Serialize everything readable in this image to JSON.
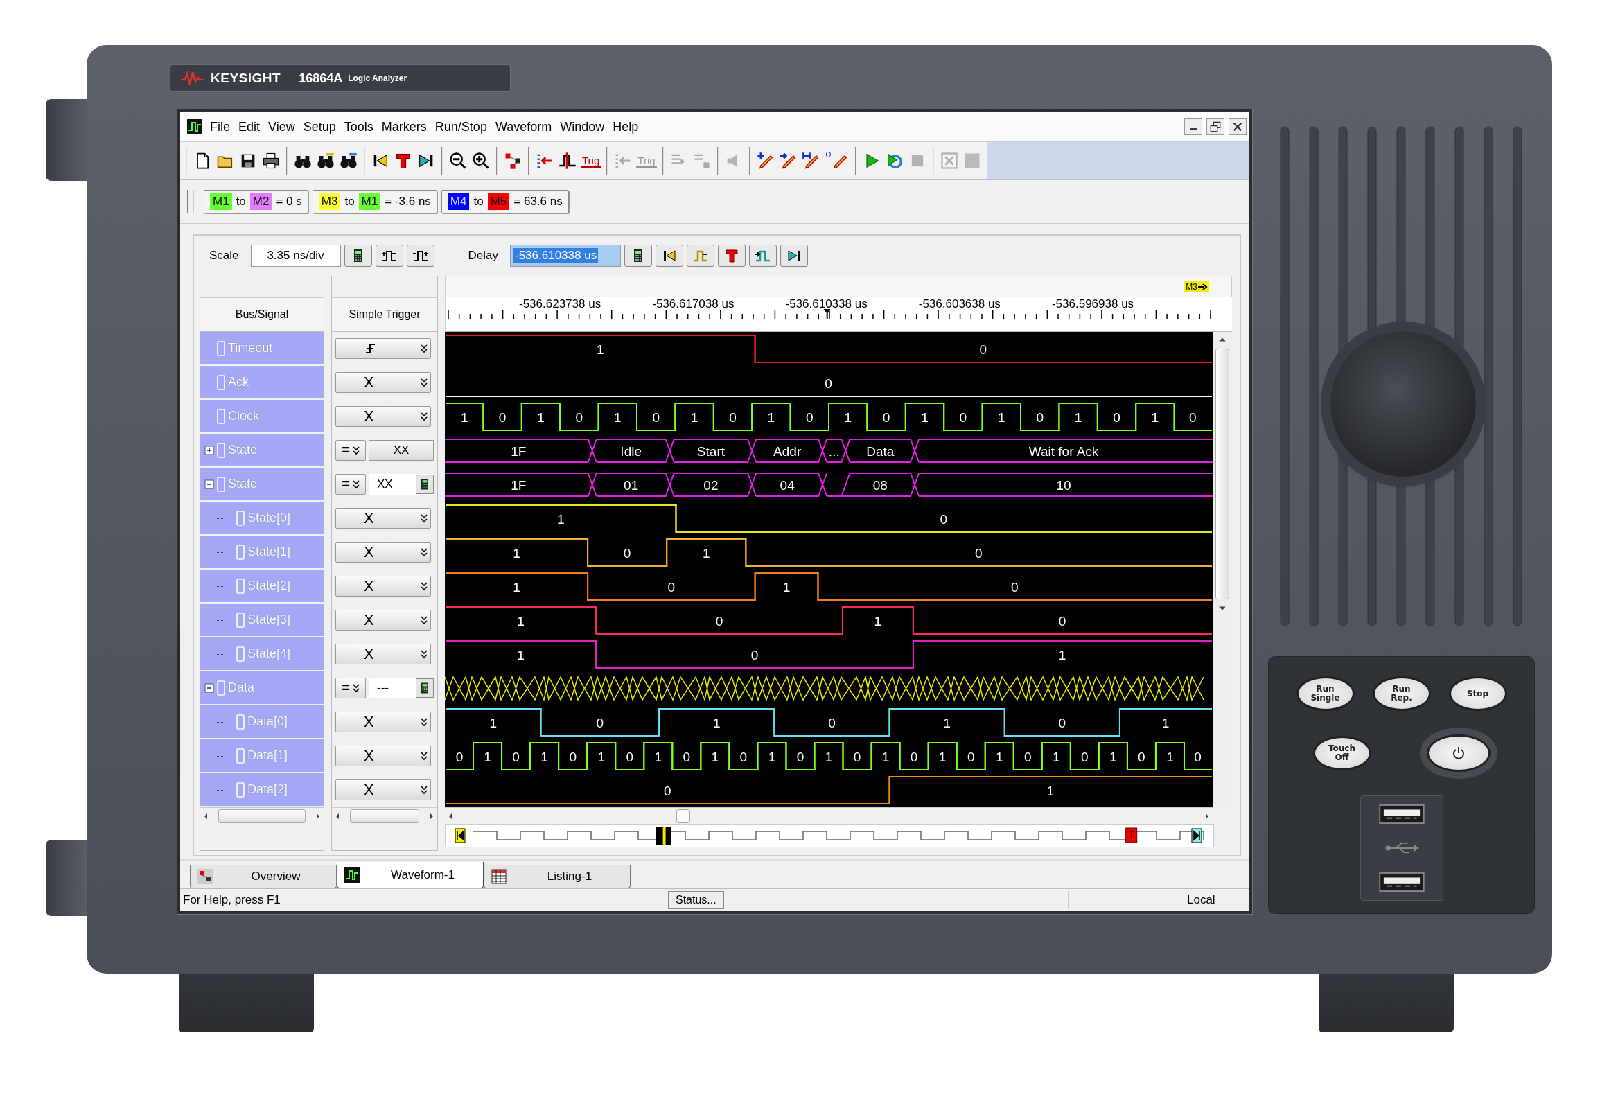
{
  "device": {
    "brand": "KEYSIGHT",
    "model": "16864A",
    "product": "Logic Analyzer"
  },
  "app": {
    "menu": [
      "File",
      "Edit",
      "View",
      "Setup",
      "Tools",
      "Markers",
      "Run/Stop",
      "Waveform",
      "Window",
      "Help"
    ],
    "toolbar": [
      [
        {
          "kind": "new",
          "disabled": false
        },
        {
          "kind": "open",
          "disabled": false
        },
        {
          "kind": "save",
          "disabled": false
        },
        {
          "kind": "print",
          "disabled": false
        }
      ],
      [
        {
          "kind": "find",
          "disabled": false
        },
        {
          "kind": "findPrev",
          "disabled": false
        },
        {
          "kind": "findNext",
          "disabled": false
        }
      ],
      [
        {
          "kind": "goStart",
          "disabled": false
        },
        {
          "kind": "trigger",
          "disabled": false
        },
        {
          "kind": "goEnd",
          "disabled": false
        }
      ],
      [
        {
          "kind": "zoomOut",
          "disabled": false
        },
        {
          "kind": "zoomIn",
          "disabled": false
        }
      ],
      [
        {
          "kind": "overview",
          "disabled": false
        }
      ],
      [
        {
          "kind": "insert",
          "disabled": false
        },
        {
          "kind": "edge",
          "disabled": false
        },
        {
          "kind": "label",
          "label": "Trig",
          "disabled": false
        }
      ],
      [
        {
          "kind": "listGrey",
          "disabled": true
        },
        {
          "kind": "label",
          "label": "Trig",
          "disabled": true
        }
      ],
      [
        {
          "kind": "moveRight",
          "disabled": true
        },
        {
          "kind": "moveSq",
          "disabled": true
        }
      ],
      [
        {
          "kind": "speaker",
          "disabled": true
        }
      ],
      [
        {
          "kind": "markerAdd",
          "disabled": false
        },
        {
          "kind": "markerArrow",
          "disabled": false
        },
        {
          "kind": "markerH",
          "disabled": false
        },
        {
          "kind": "markerOf",
          "label": "OF",
          "disabled": false
        }
      ],
      [
        {
          "kind": "run",
          "disabled": false
        },
        {
          "kind": "runRepeat",
          "disabled": false
        },
        {
          "kind": "stop",
          "disabled": true
        }
      ],
      [
        {
          "kind": "cancel",
          "disabled": true
        },
        {
          "kind": "square",
          "disabled": true
        }
      ]
    ],
    "marker_measurements": [
      {
        "from": {
          "label": "M1",
          "color": "#66ff33"
        },
        "joiner": "to",
        "to": {
          "label": "M2",
          "color": "#e07cff"
        },
        "result": "= 0 s"
      },
      {
        "from": {
          "label": "M3",
          "color": "#ffff33"
        },
        "joiner": "to",
        "to": {
          "label": "M1",
          "color": "#66ff33"
        },
        "result": "= -3.6 ns"
      },
      {
        "from": {
          "label": "M4",
          "color": "#0000ff"
        },
        "joiner": "to",
        "to": {
          "label": "M5",
          "color": "#ff0000"
        },
        "result": "= 63.6 ns"
      }
    ],
    "scale": {
      "label": "Scale",
      "value": "3.35 ns/div"
    },
    "delay": {
      "label": "Delay",
      "value": "-536.610338 us"
    },
    "columns": [
      "Bus/Signal",
      "Simple Trigger"
    ],
    "marker_flag": "M3",
    "ruler": [
      "-536.623738 us",
      "-536.617038 us",
      "-536.610338 us",
      "-536.603638 us",
      "-536.596938 us"
    ],
    "signals": [
      {
        "name": "Timeout",
        "color": "#ff1a1a",
        "trigger": {
          "kind": "edge"
        },
        "waveform": {
          "kind": "bit",
          "segments": [
            {
              "value": "1",
              "high": true
            },
            {
              "value": "0",
              "high": false
            }
          ]
        }
      },
      {
        "name": "Ack",
        "color": "#ffffff",
        "trigger": {
          "kind": "select",
          "value": "X"
        },
        "waveform": {
          "kind": "bit",
          "segments": [
            {
              "value": "0",
              "high": false
            }
          ]
        }
      },
      {
        "name": "Clock",
        "color": "#7fff1f",
        "trigger": {
          "kind": "select",
          "value": "X"
        },
        "waveform": {
          "kind": "clock",
          "segments": [
            {
              "value": "1",
              "high": true
            },
            {
              "value": "0",
              "high": false
            },
            {
              "value": "1",
              "high": true
            },
            {
              "value": "0",
              "high": false
            },
            {
              "value": "1",
              "high": true
            },
            {
              "value": "0",
              "high": false
            },
            {
              "value": "1",
              "high": true
            },
            {
              "value": "0",
              "high": false
            },
            {
              "value": "1",
              "high": true
            },
            {
              "value": "0",
              "high": false
            },
            {
              "value": "1",
              "high": true
            },
            {
              "value": "0",
              "high": false
            },
            {
              "value": "1",
              "high": true
            },
            {
              "value": "0",
              "high": false
            },
            {
              "value": "1",
              "high": true
            },
            {
              "value": "0",
              "high": false
            },
            {
              "value": "1",
              "high": true
            },
            {
              "value": "0",
              "high": false
            },
            {
              "value": "1",
              "high": true
            },
            {
              "value": "0",
              "high": false
            }
          ]
        }
      },
      {
        "name": "State",
        "expanded": false,
        "color": "#e81ee8",
        "trigger": {
          "kind": "bus",
          "operator": "=",
          "value": "XX",
          "calculator": false
        },
        "waveform": {
          "kind": "bus",
          "segments": [
            {
              "value": "1F"
            },
            {
              "value": "Idle"
            },
            {
              "value": "Start"
            },
            {
              "value": "Addr"
            },
            {
              "value": "..."
            },
            {
              "value": "Data"
            },
            {
              "value": "Wait for Ack"
            }
          ]
        }
      },
      {
        "name": "State",
        "expanded": true,
        "color": "#e81ee8",
        "trigger": {
          "kind": "bus",
          "operator": "=",
          "value": "XX",
          "calculator": true
        },
        "waveform": {
          "kind": "bus",
          "segments": [
            {
              "value": "1F"
            },
            {
              "value": "01"
            },
            {
              "value": "02"
            },
            {
              "value": "04"
            },
            {
              "value": "08"
            },
            {
              "value": "10"
            }
          ]
        },
        "children": [
          {
            "name": "State[0]",
            "color": "#e8e820",
            "trigger": {
              "kind": "select",
              "value": "X"
            },
            "waveform": {
              "kind": "bit",
              "segments": [
                {
                  "value": "1",
                  "high": true
                },
                {
                  "value": "0",
                  "high": false
                }
              ]
            }
          },
          {
            "name": "State[1]",
            "color": "#f0b030",
            "trigger": {
              "kind": "select",
              "value": "X"
            },
            "waveform": {
              "kind": "bit",
              "segments": [
                {
                  "value": "1",
                  "high": true
                },
                {
                  "value": "0",
                  "high": false
                },
                {
                  "value": "1",
                  "high": true
                },
                {
                  "value": "0",
                  "high": false
                }
              ]
            }
          },
          {
            "name": "State[2]",
            "color": "#f08020",
            "trigger": {
              "kind": "select",
              "value": "X"
            },
            "waveform": {
              "kind": "bit",
              "segments": [
                {
                  "value": "1",
                  "high": true
                },
                {
                  "value": "0",
                  "high": false
                },
                {
                  "value": "1",
                  "high": true
                },
                {
                  "value": "0",
                  "high": false
                }
              ]
            }
          },
          {
            "name": "State[3]",
            "color": "#ff2a5a",
            "trigger": {
              "kind": "select",
              "value": "X"
            },
            "waveform": {
              "kind": "bit",
              "segments": [
                {
                  "value": "1",
                  "high": true
                },
                {
                  "value": "0",
                  "high": false
                },
                {
                  "value": "1",
                  "high": true
                },
                {
                  "value": "0",
                  "high": false
                }
              ]
            }
          },
          {
            "name": "State[4]",
            "color": "#e020c0",
            "trigger": {
              "kind": "select",
              "value": "X"
            },
            "waveform": {
              "kind": "bit",
              "segments": [
                {
                  "value": "1",
                  "high": true
                },
                {
                  "value": "0",
                  "high": false
                },
                {
                  "value": "1",
                  "high": true
                }
              ]
            }
          }
        ]
      },
      {
        "name": "Data",
        "expanded": true,
        "color": "#e6e600",
        "trigger": {
          "kind": "bus",
          "operator": "=",
          "value": "---",
          "calculator": true
        },
        "waveform": {
          "kind": "pattern"
        },
        "children": [
          {
            "name": "Data[0]",
            "color": "#66e0f0",
            "trigger": {
              "kind": "select",
              "value": "X"
            },
            "waveform": {
              "kind": "bit",
              "segments": [
                {
                  "value": "1",
                  "high": true
                },
                {
                  "value": "0",
                  "high": false
                },
                {
                  "value": "1",
                  "high": true
                },
                {
                  "value": "0",
                  "high": false
                },
                {
                  "value": "1",
                  "high": true
                },
                {
                  "value": "0",
                  "high": false
                },
                {
                  "value": "1",
                  "high": true
                }
              ]
            }
          },
          {
            "name": "Data[1]",
            "color": "#7fff1f",
            "trigger": {
              "kind": "select",
              "value": "X"
            },
            "waveform": {
              "kind": "clock",
              "segments": [
                {
                  "value": "0",
                  "high": false
                },
                {
                  "value": "1",
                  "high": true
                },
                {
                  "value": "0",
                  "high": false
                },
                {
                  "value": "1",
                  "high": true
                },
                {
                  "value": "0",
                  "high": false
                },
                {
                  "value": "1",
                  "high": true
                },
                {
                  "value": "0",
                  "high": false
                },
                {
                  "value": "1",
                  "high": true
                },
                {
                  "value": "0",
                  "high": false
                },
                {
                  "value": "1",
                  "high": true
                },
                {
                  "value": "0",
                  "high": false
                },
                {
                  "value": "1",
                  "high": true
                },
                {
                  "value": "0",
                  "high": false
                },
                {
                  "value": "1",
                  "high": true
                },
                {
                  "value": "0",
                  "high": false
                },
                {
                  "value": "1",
                  "high": true
                },
                {
                  "value": "0",
                  "high": false
                },
                {
                  "value": "1",
                  "high": true
                },
                {
                  "value": "0",
                  "high": false
                },
                {
                  "value": "1",
                  "high": true
                },
                {
                  "value": "0",
                  "high": false
                },
                {
                  "value": "1",
                  "high": true
                },
                {
                  "value": "0",
                  "high": false
                },
                {
                  "value": "1",
                  "high": true
                },
                {
                  "value": "0",
                  "high": false
                },
                {
                  "value": "1",
                  "high": true
                },
                {
                  "value": "0",
                  "high": false
                }
              ]
            }
          },
          {
            "name": "Data[2]",
            "color": "#f08a20",
            "trigger": {
              "kind": "select",
              "value": "X"
            },
            "waveform": {
              "kind": "bit",
              "segments": [
                {
                  "value": "0",
                  "high": false
                },
                {
                  "value": "1",
                  "high": true
                }
              ]
            }
          }
        ]
      }
    ],
    "tabs": [
      {
        "label": "Overview",
        "selected": false
      },
      {
        "label": "Waveform-1",
        "selected": true
      },
      {
        "label": "Listing-1",
        "selected": false
      }
    ],
    "status_bar": {
      "help": "For Help, press F1",
      "button": "Status...",
      "mode": "Local"
    }
  },
  "front_panel": {
    "buttons": [
      {
        "label": "Run Single"
      },
      {
        "label": "Run Rep."
      },
      {
        "label": "Stop"
      },
      {
        "label": "Touch Off"
      }
    ]
  }
}
